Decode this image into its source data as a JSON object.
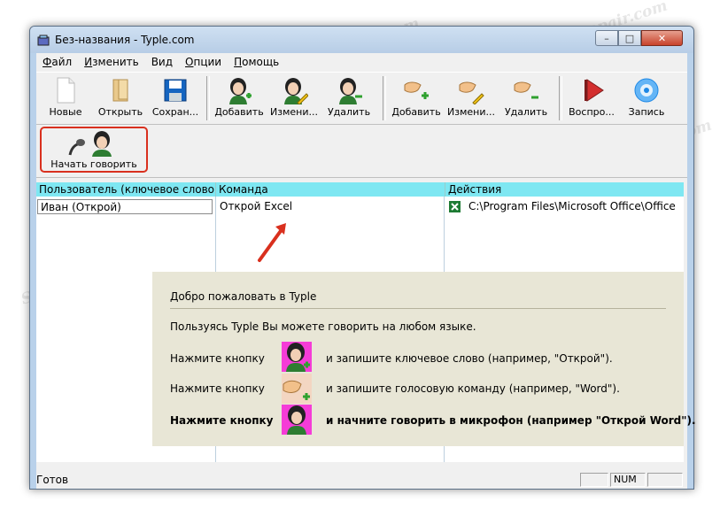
{
  "window": {
    "title": "Без-названия - Typle.com",
    "controls": {
      "minimize": "–",
      "maximize": "□",
      "close": "✕"
    }
  },
  "menu": [
    {
      "label": "Файл",
      "accel": "Ф",
      "rest": "айл"
    },
    {
      "label": "Изменить",
      "accel": "И",
      "rest": "зменить"
    },
    {
      "label": "Вид",
      "accel": "",
      "rest": "Вид"
    },
    {
      "label": "Опции",
      "accel": "О",
      "rest": "пции"
    },
    {
      "label": "Помощь",
      "accel": "П",
      "rest": "омощь"
    }
  ],
  "toolbar": {
    "new": "Новые",
    "open": "Открыть",
    "save": "Сохран...",
    "add_user": "Добавить",
    "edit_user": "Измени...",
    "delete_user": "Удалить",
    "add_command": "Добавить",
    "edit_command": "Измени...",
    "delete_command": "Удалить",
    "play": "Воспро...",
    "record": "Запись"
  },
  "toolbar2": {
    "start_speaking": "Начать говорить"
  },
  "grid": {
    "headers": [
      "Пользователь (ключевое слово)",
      "Команда",
      "Действия"
    ],
    "row": {
      "user": "Иван (Открой)",
      "command": "Открой Excel",
      "action": "C:\\Program Files\\Microsoft Office\\Office"
    }
  },
  "welcome": {
    "title": "Добро пожаловать в Typle",
    "intro": "Пользуясь Typle Вы можете говорить на любом языке.",
    "step1_prefix": "Нажмите кнопку",
    "step1_text": "и запишите ключевое слово (например, \"Открой\").",
    "step2_prefix": "Нажмите кнопку",
    "step2_text": "и запишите голосовую команду (например, \"Word\").",
    "step3_prefix": "Нажмите кнопку",
    "step3_text": "и начните говорить в микрофон (например \"Открой Word\")."
  },
  "status": {
    "text": "Готов",
    "num": "NUM"
  },
  "watermark": "Soringpcrepair.com",
  "colors": {
    "highlight": "#d9301e",
    "grid_header": "#7ee7f2",
    "face_bg": "#f53cd7"
  }
}
